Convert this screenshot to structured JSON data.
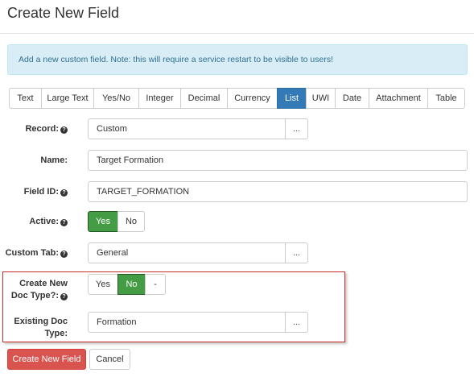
{
  "page": {
    "title": "Create New Field"
  },
  "alert": {
    "text": "Add a new custom field. Note: this will require a service restart to be visible to users!"
  },
  "type_tabs": {
    "items": [
      "Text",
      "Large Text",
      "Yes/No",
      "Integer",
      "Decimal",
      "Currency",
      "List",
      "UWI",
      "Date",
      "Attachment",
      "Table"
    ],
    "active": "List"
  },
  "form": {
    "record": {
      "label": "Record:",
      "value": "Custom",
      "button": "..."
    },
    "name": {
      "label": "Name:",
      "value": "Target Formation"
    },
    "field_id": {
      "label": "Field ID:",
      "value": "TARGET_FORMATION"
    },
    "active": {
      "label": "Active:",
      "options": [
        "Yes",
        "No"
      ],
      "selected": "Yes"
    },
    "custom_tab": {
      "label": "Custom Tab:",
      "value": "General",
      "button": "..."
    },
    "create_doc_type": {
      "label_line1": "Create New",
      "label_line2": "Doc Type?:",
      "options": [
        "Yes",
        "No",
        "-"
      ],
      "selected": "No"
    },
    "existing_doc_type": {
      "label_line1": "Existing Doc",
      "label_line2": "Type:",
      "value": "Formation",
      "button": "..."
    }
  },
  "actions": {
    "create_label": "Create New Field",
    "cancel_label": "Cancel"
  },
  "colors": {
    "primary_tab": "#337ab7",
    "toggle_on": "#449d44",
    "danger": "#d9534f",
    "alert_bg": "#d9edf7",
    "highlight_border": "#c9302c"
  },
  "icons": {
    "help": "question-circle-icon"
  }
}
